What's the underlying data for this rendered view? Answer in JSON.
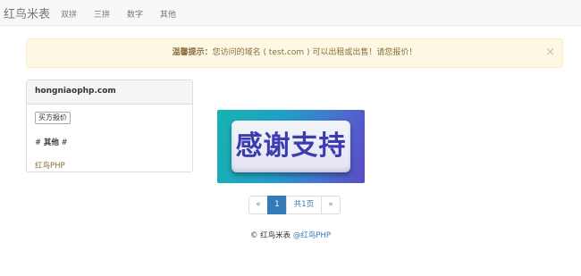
{
  "nav": {
    "brand": "红鸟米表",
    "items": [
      "双拼",
      "三拼",
      "数字",
      "其他"
    ]
  },
  "alert": {
    "strong": "温馨提示：",
    "message": "您访问的域名 ( test.com ) 可以出租或出售！请您报价！",
    "close": "×"
  },
  "panel": {
    "title": "hongniaophp.com",
    "buy_button": "买方报价",
    "tag_prefix": "#",
    "tag_name": "其他",
    "tag_suffix": "#",
    "tag_link": "红鸟PHP"
  },
  "banner": {
    "text": "感谢支持"
  },
  "pagination": {
    "prev": "«",
    "current": "1",
    "total": "共1页",
    "next": "»"
  },
  "footer": {
    "copyright": "©",
    "site": "红鸟米表",
    "link": "@红鸟PHP"
  },
  "colors": {
    "alert_bg": "#fcf8e3",
    "alert_text": "#8a6d3b",
    "link": "#337ab7",
    "active_page": "#337ab7"
  }
}
